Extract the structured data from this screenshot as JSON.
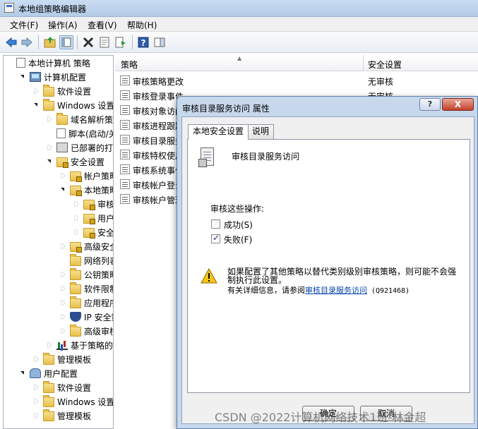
{
  "window": {
    "title": "本地组策略编辑器"
  },
  "menu": [
    "文件(F)",
    "操作(A)",
    "查看(V)",
    "帮助(H)"
  ],
  "toolbar": {
    "icons": [
      "back-arrow-icon",
      "forward-arrow-icon",
      "up-folder-icon",
      "show-hide-tree-icon",
      "delete-icon",
      "properties-icon",
      "export-list-icon",
      "help-icon",
      "show-pane-icon"
    ]
  },
  "tree": [
    {
      "label": "本地计算机 策略",
      "indent": 0,
      "expander": "",
      "icon": "doc"
    },
    {
      "label": "计算机配置",
      "indent": 1,
      "expander": "open",
      "icon": "computer"
    },
    {
      "label": "软件设置",
      "indent": 2,
      "expander": "closed",
      "icon": "folder"
    },
    {
      "label": "Windows 设置",
      "indent": 2,
      "expander": "open",
      "icon": "folder"
    },
    {
      "label": "域名解析策略",
      "indent": 3,
      "expander": "closed",
      "icon": "folder"
    },
    {
      "label": "脚本(启动/关",
      "indent": 3,
      "expander": "",
      "icon": "doc"
    },
    {
      "label": "已部署的打印",
      "indent": 3,
      "expander": "closed",
      "icon": "printer"
    },
    {
      "label": "安全设置",
      "indent": 3,
      "expander": "open",
      "icon": "lockfolder"
    },
    {
      "label": "帐户策略",
      "indent": 4,
      "expander": "closed",
      "icon": "lockfolder"
    },
    {
      "label": "本地策略",
      "indent": 4,
      "expander": "open",
      "icon": "lockfolder"
    },
    {
      "label": "审核策",
      "indent": 5,
      "expander": "closed",
      "icon": "lockfolder"
    },
    {
      "label": "用户权",
      "indent": 5,
      "expander": "closed",
      "icon": "lockfolder"
    },
    {
      "label": "安全选",
      "indent": 5,
      "expander": "closed",
      "icon": "lockfolder"
    },
    {
      "label": "高级安全",
      "indent": 4,
      "expander": "closed",
      "icon": "lockfolder"
    },
    {
      "label": "网络列表管",
      "indent": 4,
      "expander": "",
      "icon": "folder"
    },
    {
      "label": "公钥策略",
      "indent": 4,
      "expander": "closed",
      "icon": "folder"
    },
    {
      "label": "软件限制策",
      "indent": 4,
      "expander": "closed",
      "icon": "folder"
    },
    {
      "label": "应用程序控",
      "indent": 4,
      "expander": "closed",
      "icon": "folder"
    },
    {
      "label": "IP 安全策",
      "indent": 4,
      "expander": "closed",
      "icon": "shield"
    },
    {
      "label": "高级审核策",
      "indent": 4,
      "expander": "closed",
      "icon": "folder"
    },
    {
      "label": "基于策略的 Q",
      "indent": 3,
      "expander": "closed",
      "icon": "chart"
    },
    {
      "label": "管理模板",
      "indent": 2,
      "expander": "closed",
      "icon": "folder"
    },
    {
      "label": "用户配置",
      "indent": 1,
      "expander": "open",
      "icon": "users"
    },
    {
      "label": "软件设置",
      "indent": 2,
      "expander": "closed",
      "icon": "folder"
    },
    {
      "label": "Windows 设置",
      "indent": 2,
      "expander": "closed",
      "icon": "folder"
    },
    {
      "label": "管理模板",
      "indent": 2,
      "expander": "closed",
      "icon": "folder"
    }
  ],
  "list": {
    "col_policy": "策略",
    "col_setting": "安全设置",
    "rows": [
      {
        "name": "审核策略更改",
        "value": "无审核"
      },
      {
        "name": "审核登录事件",
        "value": "无审核"
      },
      {
        "name": "审核对象访问",
        "value": ""
      },
      {
        "name": "审核进程跟踪",
        "value": ""
      },
      {
        "name": "审核目录服务访问",
        "value": ""
      },
      {
        "name": "审核特权使用",
        "value": ""
      },
      {
        "name": "审核系统事件",
        "value": ""
      },
      {
        "name": "审核帐户登录事件",
        "value": ""
      },
      {
        "name": "审核帐户管理",
        "value": ""
      }
    ]
  },
  "dialog": {
    "title": "审核目录服务访问 属性",
    "help_label": "?",
    "close_label": "X",
    "tabs": [
      "本地安全设置",
      "说明"
    ],
    "policy_name": "审核目录服务访问",
    "section_label": "审核这些操作:",
    "success_label": "成功(S)",
    "success_checked": false,
    "failure_label": "失败(F)",
    "failure_checked": true,
    "warning_line1": "如果配置了其他策略以替代类别级别审核策略，则可能不会强制执行此设置。",
    "warning_line2_prefix": "有关详细信息，请参阅",
    "warning_link": "审核目录服务访问",
    "warning_kb": "(Q921468)",
    "ok_label": "确定",
    "cancel_label": "取消"
  },
  "watermark": "CSDN @2022计算机网络技术1班-林金超"
}
